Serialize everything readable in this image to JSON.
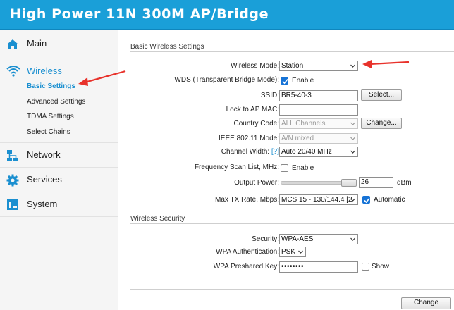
{
  "header": {
    "title": "High Power 11N 300M AP/Bridge"
  },
  "sidebar": {
    "main_label": "Main",
    "wireless_label": "Wireless",
    "wireless_sub": [
      {
        "label": "Basic Settings",
        "active": true
      },
      {
        "label": "Advanced Settings"
      },
      {
        "label": "TDMA Settings"
      },
      {
        "label": "Select Chains"
      }
    ],
    "network_label": "Network",
    "services_label": "Services",
    "system_label": "System"
  },
  "basic": {
    "section_title": "Basic Wireless Settings",
    "wireless_mode": {
      "label": "Wireless Mode:",
      "value": "Station"
    },
    "wds": {
      "label": "WDS (Transparent Bridge Mode):",
      "checkbox_label": "Enable",
      "checked": true
    },
    "ssid": {
      "label": "SSID:",
      "value": "BR5-40-3",
      "button": "Select..."
    },
    "lock_ap_mac": {
      "label": "Lock to AP MAC:",
      "value": ""
    },
    "country_code": {
      "label": "Country Code:",
      "value": "ALL Channels",
      "button": "Change..."
    },
    "ieee_mode": {
      "label": "IEEE 802.11 Mode:",
      "value": "A/N mixed"
    },
    "channel_width": {
      "label": "Channel Width:",
      "help": "[?]",
      "value": "Auto 20/40 MHz"
    },
    "freq_scan": {
      "label": "Frequency Scan List, MHz:",
      "checkbox_label": "Enable",
      "checked": false
    },
    "output_power": {
      "label": "Output Power:",
      "value": "26",
      "unit": "dBm"
    },
    "max_tx_rate": {
      "label": "Max TX Rate, Mbps:",
      "value": "MCS 15 - 130/144.4 [2",
      "checkbox_label": "Automatic",
      "checked": true
    }
  },
  "security": {
    "section_title": "Wireless Security",
    "security": {
      "label": "Security:",
      "value": "WPA-AES"
    },
    "wpa_auth": {
      "label": "WPA Authentication:",
      "value": "PSK"
    },
    "wpa_key": {
      "label": "WPA Preshared Key:",
      "value": "••••••••",
      "checkbox_label": "Show",
      "checked": false
    }
  },
  "footer": {
    "change_button": "Change"
  },
  "colors": {
    "header": "#1a9fd8",
    "accent": "#1a8fd0",
    "annotation_arrow": "#e8322b"
  }
}
